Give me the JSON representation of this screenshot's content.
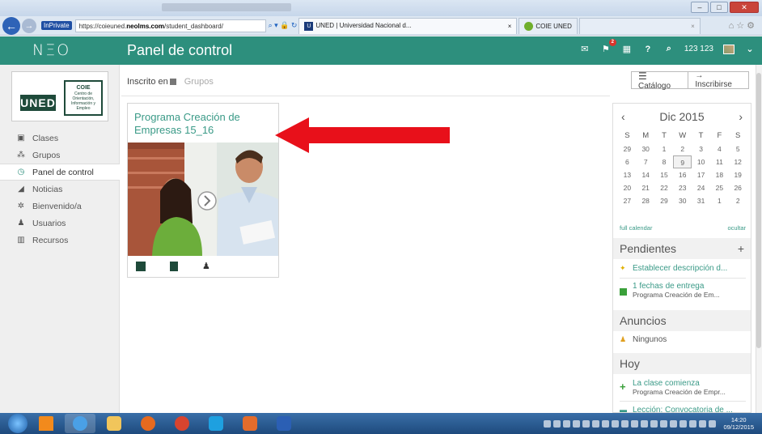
{
  "browser": {
    "inprivate_label": "InPrivate",
    "url_prefix": "https://coieuned.",
    "url_domain": "neolms.com",
    "url_path": "/student_dashboard/",
    "tabs": [
      {
        "label": "UNED | Universidad Nacional d...",
        "active": true
      },
      {
        "label": "COIE UNED",
        "active": false
      }
    ]
  },
  "app": {
    "logo": "NΞO",
    "page_title": "Panel de control",
    "user_name": "123 123",
    "notification_count": "2"
  },
  "sidebar": {
    "logo_text": "UNED",
    "coie_title": "COIE",
    "coie_sub": "Centro de Orientación, Información y Empleo",
    "items": [
      {
        "label": "Clases",
        "icon": "classes-icon"
      },
      {
        "label": "Grupos",
        "icon": "groups-icon"
      },
      {
        "label": "Panel de control",
        "icon": "dashboard-icon",
        "active": true
      },
      {
        "label": "Noticias",
        "icon": "news-icon"
      },
      {
        "label": "Bienvenido/a",
        "icon": "welcome-icon"
      },
      {
        "label": "Usuarios",
        "icon": "users-icon"
      },
      {
        "label": "Recursos",
        "icon": "resources-icon"
      }
    ]
  },
  "main": {
    "subnav": {
      "enrolled": "Inscrito en",
      "groups": "Grupos"
    },
    "toolbar": {
      "catalog": "Catálogo",
      "enroll": "Inscribirse"
    },
    "course_card": {
      "title": "Programa Creación de Empresas 15_16"
    }
  },
  "calendar": {
    "month": "Dic 2015",
    "prev": "‹",
    "next": "›",
    "weekdays": [
      "S",
      "M",
      "T",
      "W",
      "T",
      "F",
      "S"
    ],
    "weeks": [
      [
        "29",
        "30",
        "1",
        "2",
        "3",
        "4",
        "5"
      ],
      [
        "6",
        "7",
        "8",
        "9",
        "10",
        "11",
        "12"
      ],
      [
        "13",
        "14",
        "15",
        "16",
        "17",
        "18",
        "19"
      ],
      [
        "20",
        "21",
        "22",
        "23",
        "24",
        "25",
        "26"
      ],
      [
        "27",
        "28",
        "29",
        "30",
        "31",
        "1",
        "2"
      ]
    ],
    "today": "9",
    "full_calendar": "full calendar",
    "hide": "ocultar"
  },
  "pending": {
    "title": "Pendientes",
    "add": "+",
    "items": [
      {
        "title": "Establecer descripción d...",
        "sub": ""
      },
      {
        "title": "1 fechas de entrega",
        "sub": "Programa Creación de Em..."
      }
    ]
  },
  "announcements": {
    "title": "Anuncios",
    "none": "Ningunos"
  },
  "today": {
    "title": "Hoy",
    "items": [
      {
        "title": "La clase comienza",
        "sub": "Programa Creación de Empr..."
      },
      {
        "title": "Lección: Convocatoria de ...",
        "sub": ""
      }
    ]
  },
  "taskbar": {
    "time": "14:20",
    "date": "09/12/2015"
  },
  "colors": {
    "brand": "#2d8f7d",
    "accent_text": "#3a9a87",
    "arrow": "#e8101a"
  }
}
